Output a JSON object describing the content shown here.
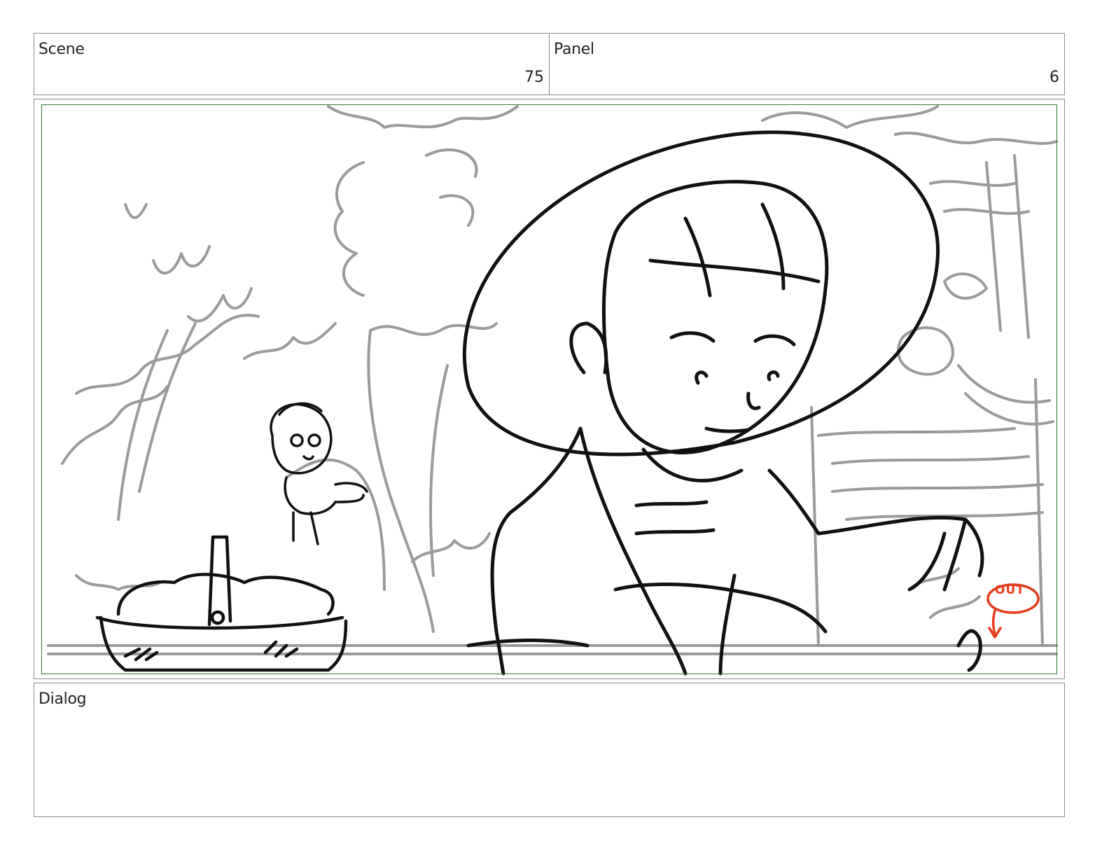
{
  "scene": {
    "label": "Scene",
    "value": "75"
  },
  "panel": {
    "label": "Panel",
    "value": "6"
  },
  "dialog": {
    "label": "Dialog",
    "value": ""
  },
  "annotation": {
    "text": "OUT",
    "color": "#e53a1c"
  },
  "colors": {
    "safe_frame": "#2e7d32",
    "sketch_dark": "#111111",
    "sketch_light": "#9a9a9a"
  }
}
